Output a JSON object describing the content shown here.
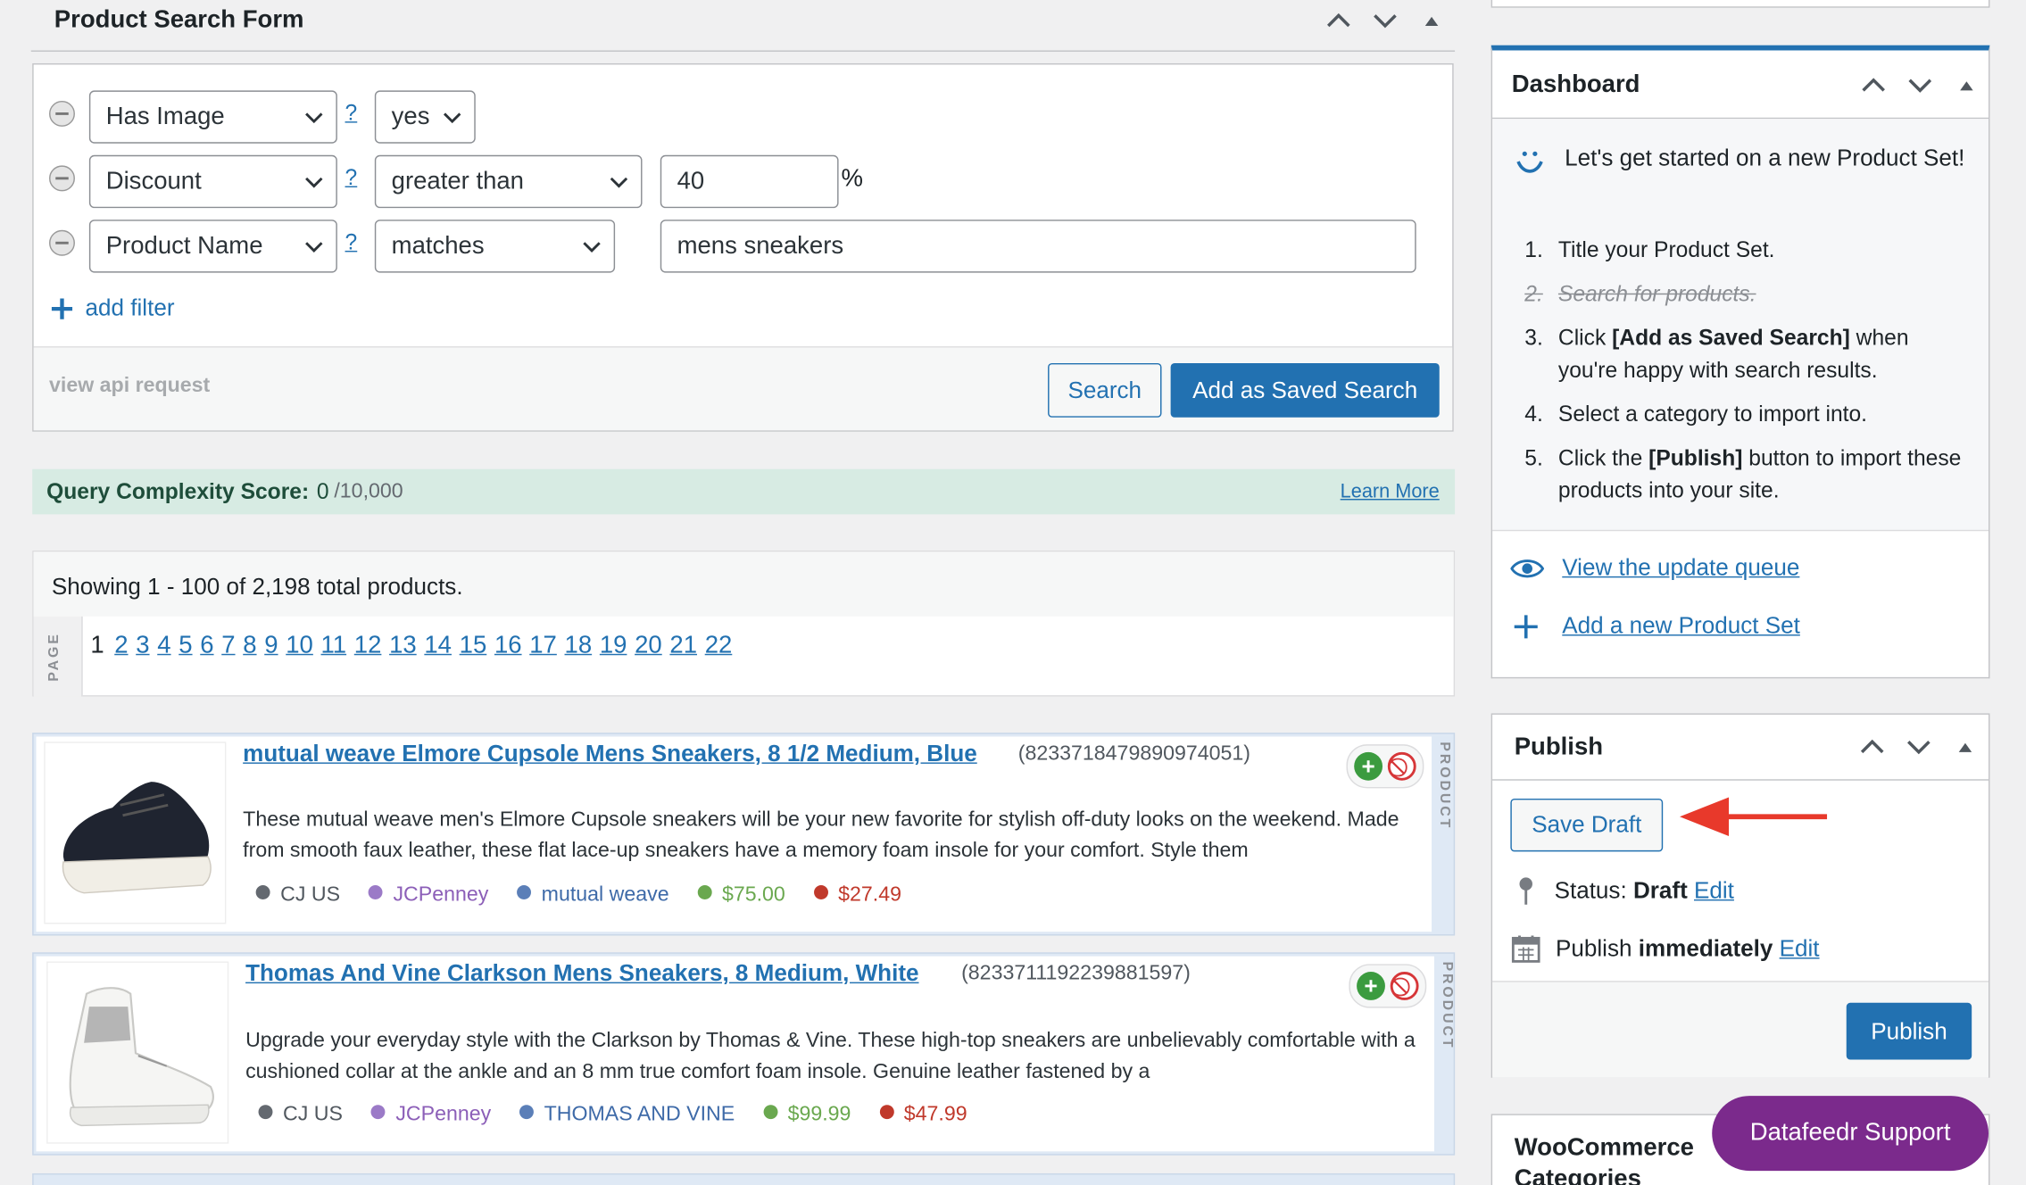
{
  "search_form": {
    "title": "Product Search Form",
    "filters": [
      {
        "field": "Has Image",
        "help": "?",
        "operator": "yes",
        "value": "",
        "suffix": ""
      },
      {
        "field": "Discount",
        "help": "?",
        "operator": "greater than",
        "value": "40",
        "suffix": "%"
      },
      {
        "field": "Product Name",
        "help": "?",
        "operator": "matches",
        "value": "mens sneakers",
        "suffix": ""
      }
    ],
    "add_filter_label": "add filter",
    "view_api_label": "view api request",
    "search_label": "Search",
    "save_search_label": "Add as Saved Search"
  },
  "complexity": {
    "label": "Query Complexity Score:",
    "score": "0",
    "max": "/10,000",
    "learn_more": "Learn More"
  },
  "results": {
    "summary": "Showing 1 - 100 of 2,198 total products.",
    "page_label": "PAGE",
    "current_page": "1",
    "pages": [
      "2",
      "3",
      "4",
      "5",
      "6",
      "7",
      "8",
      "9",
      "10",
      "11",
      "12",
      "13",
      "14",
      "15",
      "16",
      "17",
      "18",
      "19",
      "20",
      "21",
      "22"
    ]
  },
  "products": [
    {
      "title": "mutual weave Elmore Cupsole Mens Sneakers, 8 1/2 Medium, Blue",
      "id": "(8233718479890974051)",
      "description": "These mutual weave men's Elmore Cupsole sneakers will be your new favorite for stylish off-duty looks on the weekend. Made from smooth faux leather, these flat lace-up sneakers have a memory foam insole for your comfort. Style them",
      "network": "CJ US",
      "merchant": "JCPenney",
      "brand": "mutual weave",
      "price": "$75.00",
      "sale_price": "$27.49",
      "side_label": "PRODUCT"
    },
    {
      "title": "Thomas And Vine Clarkson Mens Sneakers, 8 Medium, White",
      "id": "(8233711192239881597)",
      "description": "Upgrade your everyday style with the Clarkson by Thomas & Vine. These high-top sneakers are unbelievably comfortable with a cushioned collar at the ankle and an 8 mm true comfort foam insole. Genuine leather fastened by a",
      "network": "CJ US",
      "merchant": "JCPenney",
      "brand": "THOMAS AND VINE",
      "price": "$99.99",
      "sale_price": "$47.99",
      "side_label": "PRODUCT"
    }
  ],
  "dashboard": {
    "title": "Dashboard",
    "intro": "Let's get started on a new Product Set!",
    "steps": [
      {
        "num": "1.",
        "text": "Title your Product Set."
      },
      {
        "num": "2.",
        "text": "Search for products."
      },
      {
        "num": "3.",
        "pre": "Click ",
        "bold": "[Add as Saved Search]",
        "post": " when you're happy with search results."
      },
      {
        "num": "4.",
        "text": "Select a category to import into."
      },
      {
        "num": "5.",
        "pre": "Click the ",
        "bold": "[Publish]",
        "post": " button to import these products into your site."
      }
    ],
    "view_queue": "View the update queue",
    "add_set": "Add a new Product Set"
  },
  "publish": {
    "title": "Publish",
    "save_draft": "Save Draft",
    "status_label": "Status:",
    "status_value": "Draft",
    "edit1": "Edit",
    "publish_label": "Publish",
    "publish_when": "immediately",
    "edit2": "Edit",
    "publish_button": "Publish"
  },
  "woo": {
    "title_line1": "WooCommerce",
    "title_line2": "Categories"
  },
  "support": {
    "label": "Datafeedr Support"
  },
  "colors": {
    "accent": "#2271b1",
    "annotation_arrow": "#e8392b",
    "support_bg": "#7b2a8c",
    "network_dot": "#646970",
    "merchant_dot": "#9b7ac7",
    "brand_dot": "#5b7fb8",
    "price_color": "#6aa84f",
    "sale_color": "#c0392b",
    "complexity_bg": "#d7ebe3"
  },
  "icons": {
    "collapse_up": "chevron-up-icon",
    "collapse_down": "chevron-down-icon",
    "toggle": "triangle-up-icon",
    "remove_filter": "minus-circle-icon",
    "add": "plus-icon",
    "smile": "smile-icon",
    "eye": "eye-icon",
    "pin": "pin-icon",
    "calendar": "calendar-icon",
    "add_product": "plus-circle-icon",
    "block_product": "block-icon"
  }
}
